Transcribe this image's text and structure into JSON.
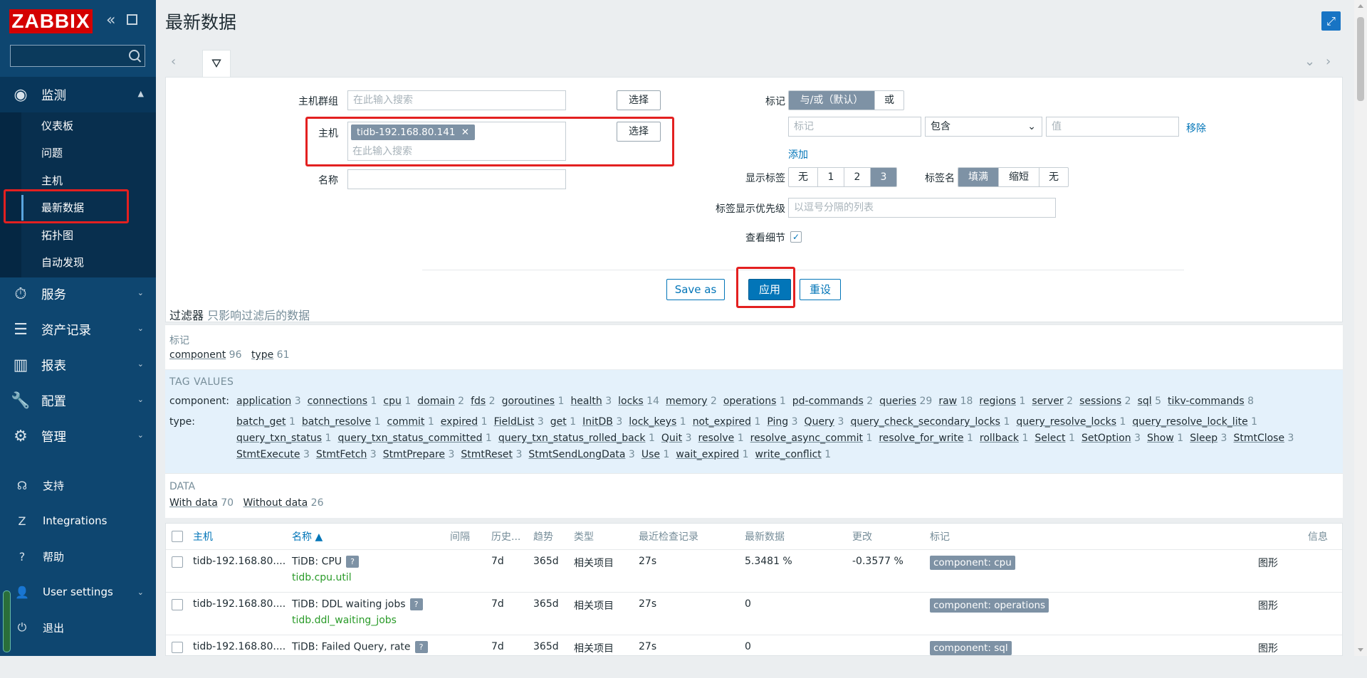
{
  "sidebar": {
    "logo": "ZABBIX",
    "search_placeholder": "",
    "sections": [
      {
        "label": "监测",
        "icon": "eye-icon"
      },
      {
        "label": "服务",
        "icon": "stopwatch-icon"
      },
      {
        "label": "资产记录",
        "icon": "list-icon"
      },
      {
        "label": "报表",
        "icon": "bar-chart-icon"
      },
      {
        "label": "配置",
        "icon": "wrench-icon"
      },
      {
        "label": "管理",
        "icon": "gear-icon"
      }
    ],
    "monitor_items": [
      "仪表板",
      "问题",
      "主机",
      "最新数据",
      "拓扑图",
      "自动发现"
    ],
    "bottom": [
      {
        "label": "支持",
        "icon": "headset-icon"
      },
      {
        "label": "Integrations",
        "icon": "zabbix-z-icon"
      },
      {
        "label": "帮助",
        "icon": "question-icon"
      },
      {
        "label": "User settings",
        "icon": "user-icon"
      },
      {
        "label": "退出",
        "icon": "power-icon"
      }
    ]
  },
  "page": {
    "title": "最新数据"
  },
  "filter": {
    "host_groups_label": "主机群组",
    "host_groups_placeholder": "在此输入搜索",
    "select_label": "选择",
    "hosts_label": "主机",
    "host_chip": "tidb-192.168.80.141",
    "hosts_placeholder": "在此输入搜索",
    "name_label": "名称",
    "tags_label": "标记",
    "tags_mode": [
      "与/或（默认）",
      "或"
    ],
    "tag_placeholder": "标记",
    "tag_operator": "包含",
    "value_placeholder": "值",
    "remove_label": "移除",
    "add_label": "添加",
    "show_tags_label": "显示标签",
    "show_tags_options": [
      "无",
      "1",
      "2",
      "3"
    ],
    "tag_name_label": "标签名",
    "tag_name_options": [
      "填满",
      "缩短",
      "无"
    ],
    "tag_priority_label": "标签显示优先级",
    "tag_priority_placeholder": "以逗号分隔的列表",
    "show_details_label": "查看细节",
    "save_as": "Save as",
    "apply": "应用",
    "reset": "重设"
  },
  "subfilter": {
    "title": "过滤器",
    "hint": "只影响过滤后的数据",
    "tags_title": "标记",
    "tags": [
      {
        "name": "component",
        "count": "96"
      },
      {
        "name": "type",
        "count": "61"
      }
    ],
    "tag_values_title": "TAG VALUES",
    "component_label": "component:",
    "component_values": [
      {
        "name": "application",
        "count": "3"
      },
      {
        "name": "connections",
        "count": "1"
      },
      {
        "name": "cpu",
        "count": "1"
      },
      {
        "name": "domain",
        "count": "2"
      },
      {
        "name": "fds",
        "count": "2"
      },
      {
        "name": "goroutines",
        "count": "1"
      },
      {
        "name": "health",
        "count": "3"
      },
      {
        "name": "locks",
        "count": "14"
      },
      {
        "name": "memory",
        "count": "2"
      },
      {
        "name": "operations",
        "count": "1"
      },
      {
        "name": "pd-commands",
        "count": "2"
      },
      {
        "name": "queries",
        "count": "29"
      },
      {
        "name": "raw",
        "count": "18"
      },
      {
        "name": "regions",
        "count": "1"
      },
      {
        "name": "server",
        "count": "2"
      },
      {
        "name": "sessions",
        "count": "2"
      },
      {
        "name": "sql",
        "count": "5"
      },
      {
        "name": "tikv-commands",
        "count": "8"
      }
    ],
    "type_label": "type:",
    "type_lines": [
      [
        {
          "name": "batch_get",
          "count": "1"
        },
        {
          "name": "batch_resolve",
          "count": "1"
        },
        {
          "name": "commit",
          "count": "1"
        },
        {
          "name": "expired",
          "count": "1"
        },
        {
          "name": "FieldList",
          "count": "3"
        },
        {
          "name": "get",
          "count": "1"
        },
        {
          "name": "InitDB",
          "count": "3"
        },
        {
          "name": "lock_keys",
          "count": "1"
        },
        {
          "name": "not_expired",
          "count": "1"
        },
        {
          "name": "Ping",
          "count": "3"
        },
        {
          "name": "Query",
          "count": "3"
        },
        {
          "name": "query_check_secondary_locks",
          "count": "1"
        },
        {
          "name": "query_resolve_locks",
          "count": "1"
        },
        {
          "name": "query_resolve_lock_lite",
          "count": "1"
        }
      ],
      [
        {
          "name": "query_txn_status",
          "count": "1"
        },
        {
          "name": "query_txn_status_committed",
          "count": "1"
        },
        {
          "name": "query_txn_status_rolled_back",
          "count": "1"
        },
        {
          "name": "Quit",
          "count": "3"
        },
        {
          "name": "resolve",
          "count": "1"
        },
        {
          "name": "resolve_async_commit",
          "count": "1"
        },
        {
          "name": "resolve_for_write",
          "count": "1"
        },
        {
          "name": "rollback",
          "count": "1"
        },
        {
          "name": "Select",
          "count": "1"
        },
        {
          "name": "SetOption",
          "count": "3"
        },
        {
          "name": "Show",
          "count": "1"
        },
        {
          "name": "Sleep",
          "count": "3"
        },
        {
          "name": "StmtClose",
          "count": "3"
        }
      ],
      [
        {
          "name": "StmtExecute",
          "count": "3"
        },
        {
          "name": "StmtFetch",
          "count": "3"
        },
        {
          "name": "StmtPrepare",
          "count": "3"
        },
        {
          "name": "StmtReset",
          "count": "3"
        },
        {
          "name": "StmtSendLongData",
          "count": "3"
        },
        {
          "name": "Use",
          "count": "1"
        },
        {
          "name": "wait_expired",
          "count": "1"
        },
        {
          "name": "write_conflict",
          "count": "1"
        }
      ]
    ],
    "data_title": "DATA",
    "data_values": [
      {
        "name": "With data",
        "count": "70"
      },
      {
        "name": "Without data",
        "count": "26"
      }
    ]
  },
  "table": {
    "headers": [
      "主机",
      "名称 ▲",
      "间隔",
      "历史...",
      "趋势",
      "类型",
      "最近检查记录",
      "最新数据",
      "更改",
      "标记",
      "信息"
    ],
    "rows": [
      {
        "host": "tidb-192.168.80....",
        "name": "TiDB: CPU",
        "key": "tidb.cpu.util",
        "history": "7d",
        "trends": "365d",
        "type": "相关项目",
        "last_check": "27s",
        "last_value": "5.3481 %",
        "change": "-0.3577 %",
        "tag": "component: cpu",
        "graph": "图形"
      },
      {
        "host": "tidb-192.168.80....",
        "name": "TiDB: DDL waiting jobs",
        "key": "tidb.ddl_waiting_jobs",
        "history": "7d",
        "trends": "365d",
        "type": "相关项目",
        "last_check": "27s",
        "last_value": "0",
        "change": "",
        "tag": "component: operations",
        "graph": "图形"
      },
      {
        "host": "tidb-192.168.80....",
        "name": "TiDB: Failed Query, rate",
        "key": "",
        "history": "7d",
        "trends": "365d",
        "type": "相关项目",
        "last_check": "27s",
        "last_value": "0",
        "change": "",
        "tag": "component: sql",
        "graph": "图形"
      }
    ]
  }
}
